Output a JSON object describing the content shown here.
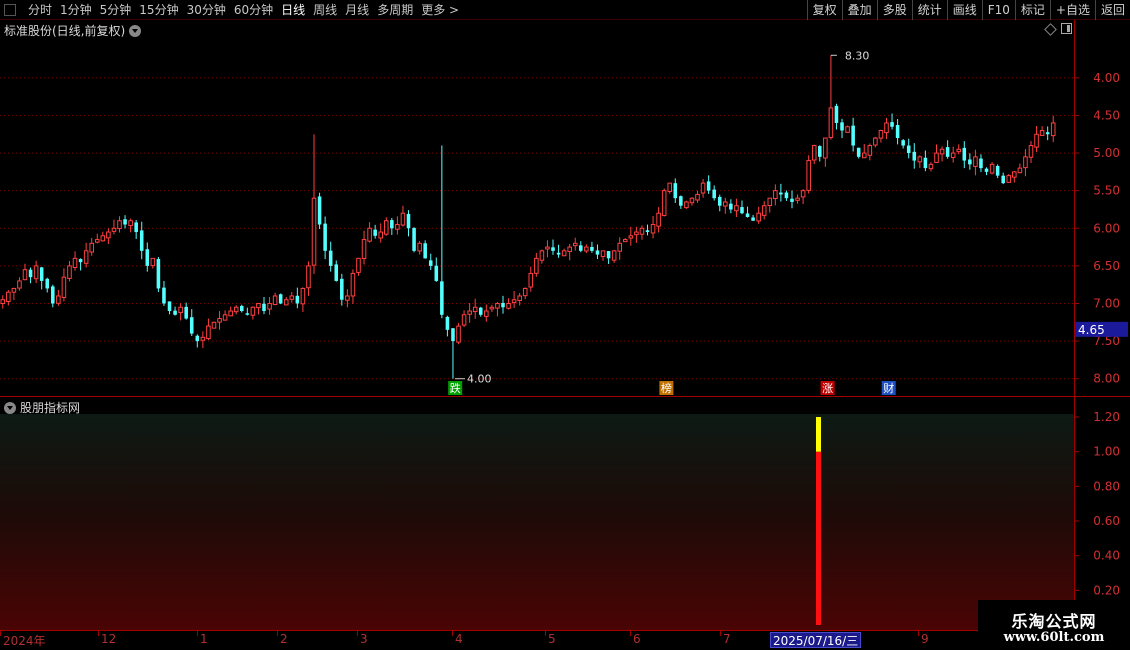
{
  "toolbar": {
    "periods": [
      "分时",
      "1分钟",
      "5分钟",
      "15分钟",
      "30分钟",
      "60分钟",
      "日线",
      "周线",
      "月线",
      "多周期",
      "更多 >"
    ],
    "active_period": "日线",
    "tools": [
      "复权",
      "叠加",
      "多股",
      "统计",
      "画线",
      "F10",
      "标记",
      "+自选",
      "返回"
    ]
  },
  "main_chart": {
    "title": "标准股份(日线,前复权)",
    "price_axis": [
      "8.00",
      "7.50",
      "7.00",
      "6.50",
      "6.00",
      "5.50",
      "5.00",
      "4.50",
      "4.00"
    ],
    "current_price": "4.65",
    "high_marker": "8.30",
    "low_marker": "4.00",
    "event_badges": [
      {
        "label": "跌",
        "color": "#00a000"
      },
      {
        "label": "榜",
        "color": "#c07000"
      },
      {
        "label": "涨",
        "color": "#c00000"
      },
      {
        "label": "财",
        "color": "#2050c0"
      }
    ],
    "colors": {
      "up": "#ff4040",
      "down": "#54ffff",
      "grid": "#7a0000"
    }
  },
  "sub_chart": {
    "title": "股朋指标网",
    "axis": [
      "1.20",
      "1.00",
      "0.80",
      "0.60",
      "0.40",
      "0.20"
    ],
    "signal": {
      "value_red": 1.0,
      "value_yellow_top": 1.2,
      "date": "2025/07/16/三"
    },
    "colors": {
      "red": "#ff1010",
      "yellow": "#ffff00"
    }
  },
  "date_axis": {
    "labels": [
      "2024年",
      "12",
      "1",
      "2",
      "3",
      "4",
      "5",
      "6",
      "7",
      "9"
    ],
    "cursor_date": "2025/07/16/三"
  },
  "watermark": {
    "title": "乐淘公式网",
    "url": "www.60lt.com"
  },
  "chart_data": {
    "type": "candlestick",
    "title": "标准股份(日线,前复权)",
    "ylim": [
      3.85,
      8.45
    ],
    "y_ticks": [
      4.0,
      4.5,
      5.0,
      5.5,
      6.0,
      6.5,
      7.0,
      7.5,
      8.0
    ],
    "x_month_labels": [
      "2024年",
      "12",
      "1",
      "2",
      "3",
      "4",
      "5",
      "6",
      "7",
      "9"
    ],
    "close_series": [
      5.05,
      5.15,
      5.2,
      5.3,
      5.45,
      5.35,
      5.5,
      5.3,
      5.2,
      5.0,
      5.1,
      5.35,
      5.5,
      5.6,
      5.55,
      5.7,
      5.8,
      5.85,
      5.9,
      5.95,
      6.0,
      6.1,
      6.05,
      6.1,
      5.95,
      5.7,
      5.5,
      5.6,
      5.2,
      5.0,
      4.9,
      4.85,
      4.95,
      4.8,
      4.6,
      4.5,
      4.55,
      4.7,
      4.75,
      4.8,
      4.85,
      4.9,
      4.95,
      4.9,
      4.85,
      4.95,
      5.0,
      4.9,
      5.0,
      5.1,
      5.0,
      5.05,
      5.1,
      5.0,
      5.2,
      5.5,
      6.4,
      6.05,
      5.7,
      5.5,
      5.3,
      5.05,
      5.1,
      5.4,
      5.6,
      5.85,
      6.0,
      5.9,
      5.95,
      6.1,
      6.0,
      6.05,
      6.2,
      6.0,
      5.7,
      5.8,
      5.6,
      5.5,
      5.3,
      4.85,
      4.65,
      4.5,
      4.7,
      4.85,
      4.9,
      4.95,
      4.85,
      4.9,
      4.95,
      5.0,
      4.95,
      5.0,
      5.05,
      5.1,
      5.2,
      5.4,
      5.6,
      5.7,
      5.75,
      5.7,
      5.65,
      5.7,
      5.75,
      5.8,
      5.7,
      5.75,
      5.7,
      5.65,
      5.7,
      5.6,
      5.7,
      5.8,
      5.85,
      5.9,
      5.95,
      6.0,
      5.95,
      6.05,
      6.2,
      6.5,
      6.6,
      6.4,
      6.3,
      6.35,
      6.4,
      6.45,
      6.6,
      6.5,
      6.4,
      6.3,
      6.35,
      6.25,
      6.3,
      6.2,
      6.15,
      6.1,
      6.2,
      6.3,
      6.4,
      6.5,
      6.45,
      6.4,
      6.35,
      6.4,
      6.5,
      6.9,
      7.1,
      6.95,
      7.2,
      7.6,
      7.4,
      7.3,
      7.35,
      7.1,
      6.95,
      7.0,
      7.1,
      7.2,
      7.3,
      7.4,
      7.35,
      7.2,
      7.1,
      7.0,
      6.9,
      6.95,
      6.8,
      6.85,
      7.0,
      7.05,
      6.95,
      7.0,
      7.05,
      6.9,
      6.85,
      6.95,
      6.8,
      6.75,
      6.85,
      6.7,
      6.6,
      6.7,
      6.75,
      6.8,
      6.95,
      7.1,
      7.25,
      7.3,
      7.25,
      7.4
    ]
  }
}
